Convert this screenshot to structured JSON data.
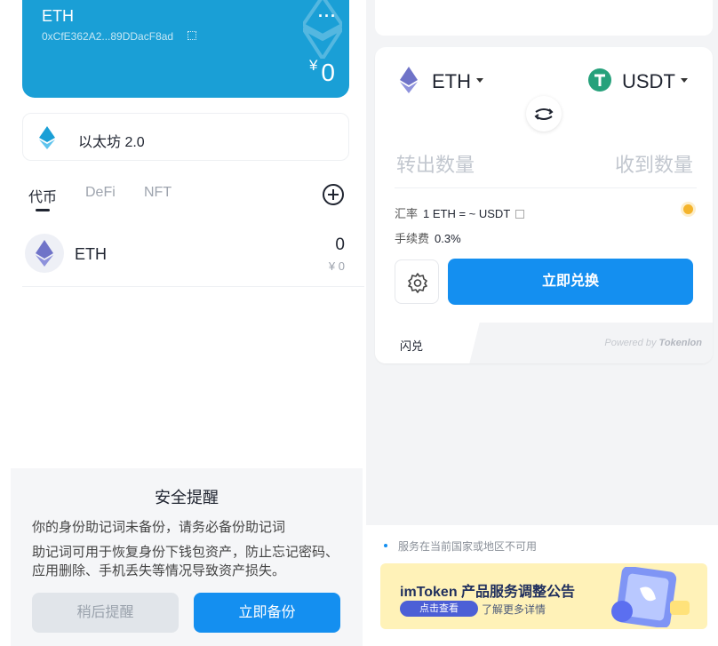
{
  "wallet_card": {
    "name": "ETH",
    "address": "0xCfE362A2...89DDacF8ad",
    "more_label": "···",
    "currency_symbol": "¥",
    "balance": "0"
  },
  "chain": {
    "label": "以太坊 2.0"
  },
  "asset_tabs": [
    {
      "label": "代币",
      "active": true
    },
    {
      "label": "DeFi",
      "active": false
    },
    {
      "label": "NFT",
      "active": false
    }
  ],
  "tokens": [
    {
      "symbol": "ETH",
      "amount": "0",
      "fiat": "¥ 0"
    }
  ],
  "backup_sheet": {
    "title": "安全提醒",
    "line1": "你的身份助记词未备份，请务必备份助记词",
    "line2": "助记词可用于恢复身份下钱包资产，防止忘记密码、应用删除、手机丢失等情况导致资产损失。",
    "later_label": "稍后提醒",
    "backup_label": "立即备份"
  },
  "swap": {
    "from_token": "ETH",
    "to_token": "USDT",
    "from_placeholder": "转出数量",
    "to_placeholder": "收到数量",
    "rate_label": "汇率",
    "rate_value": "1 ETH = ~ USDT",
    "fee_label": "手续费",
    "fee_value": "0.3%",
    "swap_button": "立即兑换",
    "tab_label": "闪兑",
    "powered_prefix": "Powered by",
    "powered_brand": "Tokenlon"
  },
  "notice": {
    "unavailable": "服务在当前国家或地区不可用",
    "banner_title": "imToken 产品服务调整公告",
    "banner_chip": "点击查看",
    "banner_more": "了解更多详情"
  },
  "colors": {
    "accent": "#148ff0",
    "card": "#1a9fd6",
    "tether": "#26a17b"
  }
}
